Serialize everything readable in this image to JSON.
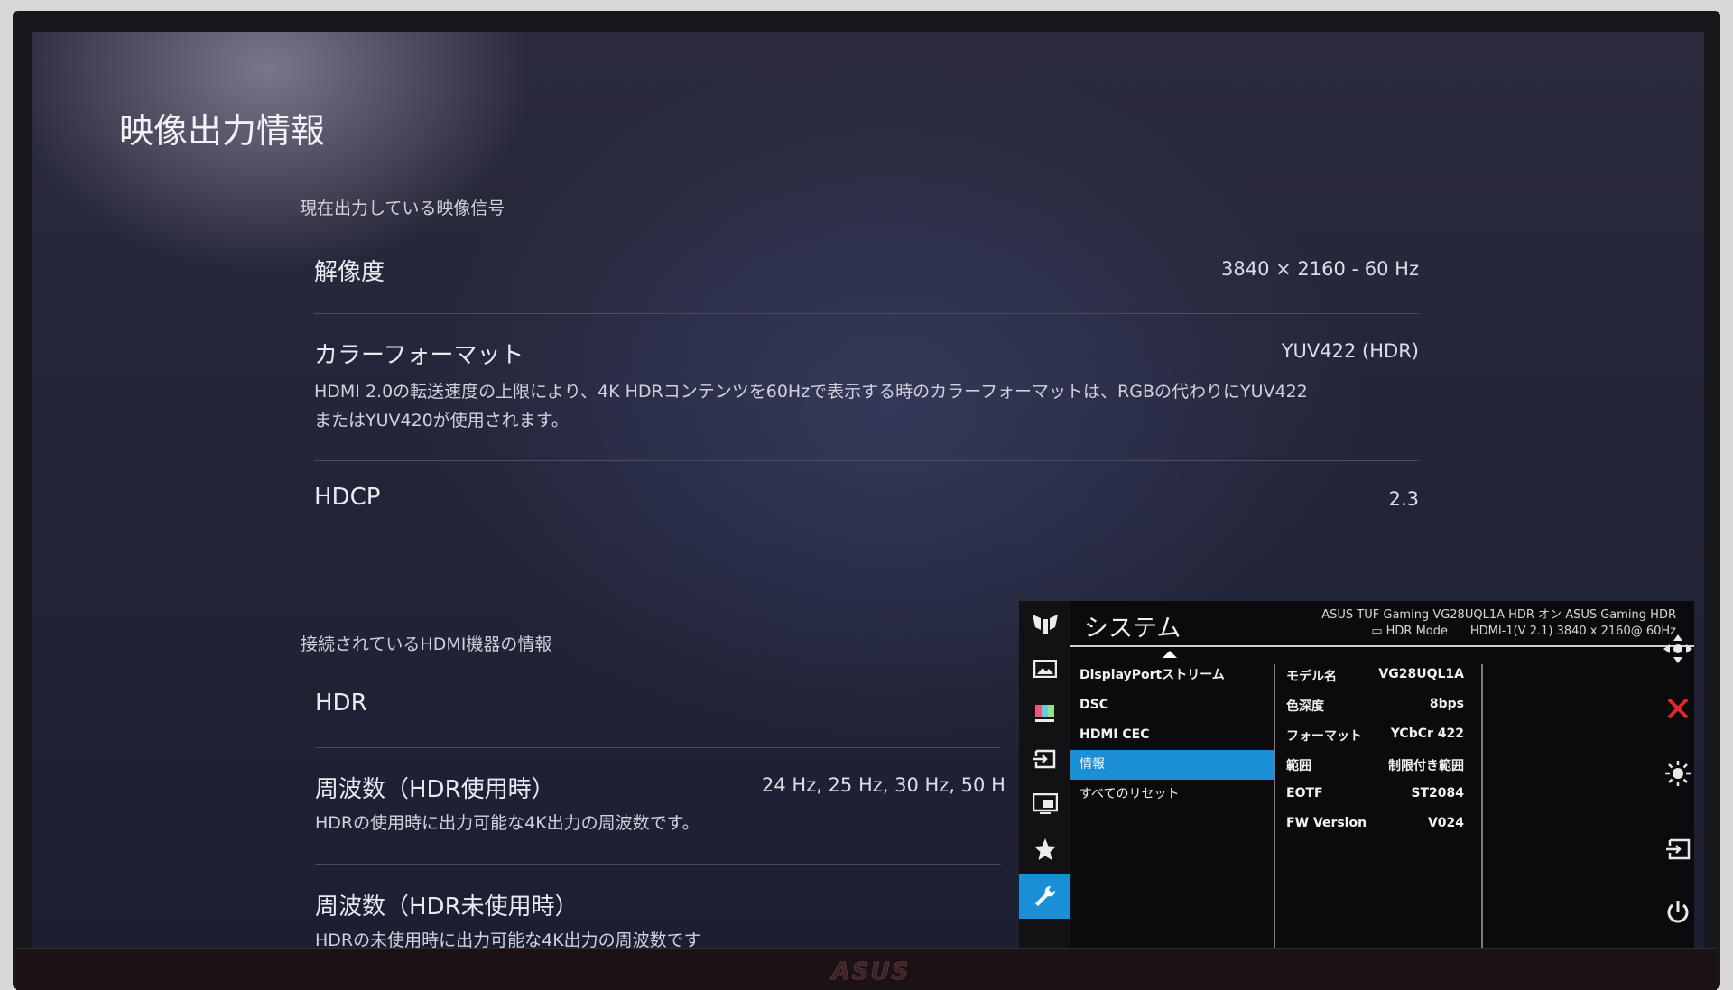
{
  "ps5": {
    "title": "映像出力情報",
    "current_signal_section": "現在出力している映像信号",
    "resolution_label": "解像度",
    "resolution_value": "3840 × 2160 - 60 Hz",
    "color_format_label": "カラーフォーマット",
    "color_format_value": "YUV422 (HDR)",
    "color_format_desc_1": "HDMI 2.0の転送速度の上限により、4K HDRコンテンツを60Hzで表示する時のカラーフォーマットは、RGBの代わりにYUV422",
    "color_format_desc_2": "またはYUV420が使用されます。",
    "hdcp_label": "HDCP",
    "hdcp_value": "2.3",
    "hdmi_device_section": "接続されているHDMI機器の情報",
    "hdr_label": "HDR",
    "freq_hdr_label": "周波数（HDR使用時）",
    "freq_hdr_value": "24 Hz, 25 Hz, 30 Hz, 50 H",
    "freq_hdr_desc": "HDRの使用時に出力可能な4K出力の周波数です。",
    "freq_nohdr_label": "周波数（HDR未使用時）",
    "freq_nohdr_desc": "HDRの未使用時に出力可能な4K出力の周波数です"
  },
  "osd": {
    "title": "システム",
    "info_line1": "ASUS TUF Gaming  VG28UQL1A  HDR オン  ASUS Gaming HDR",
    "info_line2_hdr_mode": "HDR Mode",
    "info_line2": "HDMI-1(V 2.1)  3840 x 2160@  60Hz",
    "menu_items": [
      "DisplayPortストリーム",
      "DSC",
      "HDMI CEC",
      "情報",
      "すべてのリセット"
    ],
    "active_item": "情報",
    "info": [
      {
        "key": "モデル名",
        "value": "VG28UQL1A"
      },
      {
        "key": "色深度",
        "value": "8bps"
      },
      {
        "key": "フォーマット",
        "value": "YCbCr 422"
      },
      {
        "key": "範囲",
        "value": "制限付き範囲"
      },
      {
        "key": "EOTF",
        "value": "ST2084"
      },
      {
        "key": "FW Version",
        "value": "V024"
      }
    ],
    "rail_icons": [
      "tuf-logo-icon",
      "image-icon",
      "color-icon",
      "input-icon",
      "pip-icon",
      "favorite-star-icon",
      "system-wrench-icon"
    ]
  },
  "monitor": {
    "brand": "ASUS",
    "side_buttons": [
      "joystick-icon",
      "close-icon",
      "brightness-icon",
      "input-icon",
      "power-icon"
    ],
    "accent_color": "#1a8fd6",
    "close_color": "#e0292c"
  }
}
